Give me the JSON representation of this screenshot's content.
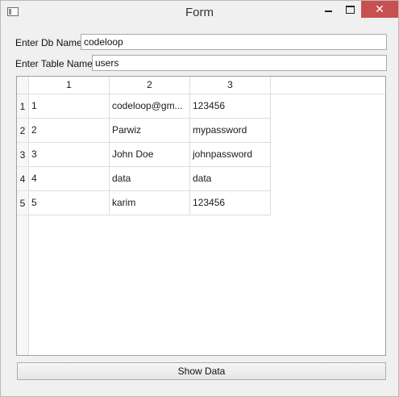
{
  "window": {
    "title": "Form"
  },
  "form": {
    "db_label": "Enter Db Name:",
    "db_value": "codeloop",
    "table_label": "Enter Table Name:",
    "table_value": "users"
  },
  "table": {
    "columns": [
      "1",
      "2",
      "3"
    ],
    "row_headers": [
      "1",
      "2",
      "3",
      "4",
      "5"
    ],
    "rows": [
      [
        "1",
        "codeloop@gm...",
        "123456"
      ],
      [
        "2",
        "Parwiz",
        "mypassword"
      ],
      [
        "3",
        "John Doe",
        "johnpassword"
      ],
      [
        "4",
        "data",
        "data"
      ],
      [
        "5",
        "karim",
        "123456"
      ]
    ]
  },
  "actions": {
    "show_data_label": "Show Data"
  },
  "colors": {
    "close_button": "#c75050",
    "window_bg": "#f0f0f0"
  },
  "icons": {
    "app": "window-app-icon",
    "min": "minimize-icon",
    "max": "maximize-icon",
    "close": "close-icon"
  }
}
